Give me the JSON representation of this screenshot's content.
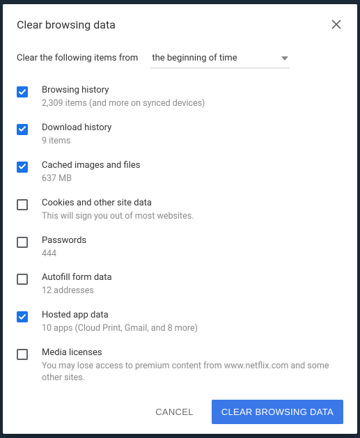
{
  "dialog": {
    "title": "Clear browsing data",
    "time_label": "Clear the following items from",
    "time_value": "the beginning of time"
  },
  "items": [
    {
      "title": "Browsing history",
      "subtitle": "2,309 items (and more on synced devices)",
      "checked": true
    },
    {
      "title": "Download history",
      "subtitle": "9 items",
      "checked": true
    },
    {
      "title": "Cached images and files",
      "subtitle": "637 MB",
      "checked": true
    },
    {
      "title": "Cookies and other site data",
      "subtitle": "This will sign you out of most websites.",
      "checked": false
    },
    {
      "title": "Passwords",
      "subtitle": "444",
      "checked": false
    },
    {
      "title": "Autofill form data",
      "subtitle": "12 addresses",
      "checked": false
    },
    {
      "title": "Hosted app data",
      "subtitle": "10 apps (Cloud Print, Gmail, and 8 more)",
      "checked": true
    },
    {
      "title": "Media licenses",
      "subtitle": "You may lose access to premium content from www.netflix.com and some other sites.",
      "checked": false
    }
  ],
  "buttons": {
    "cancel": "CANCEL",
    "confirm": "CLEAR BROWSING DATA"
  }
}
